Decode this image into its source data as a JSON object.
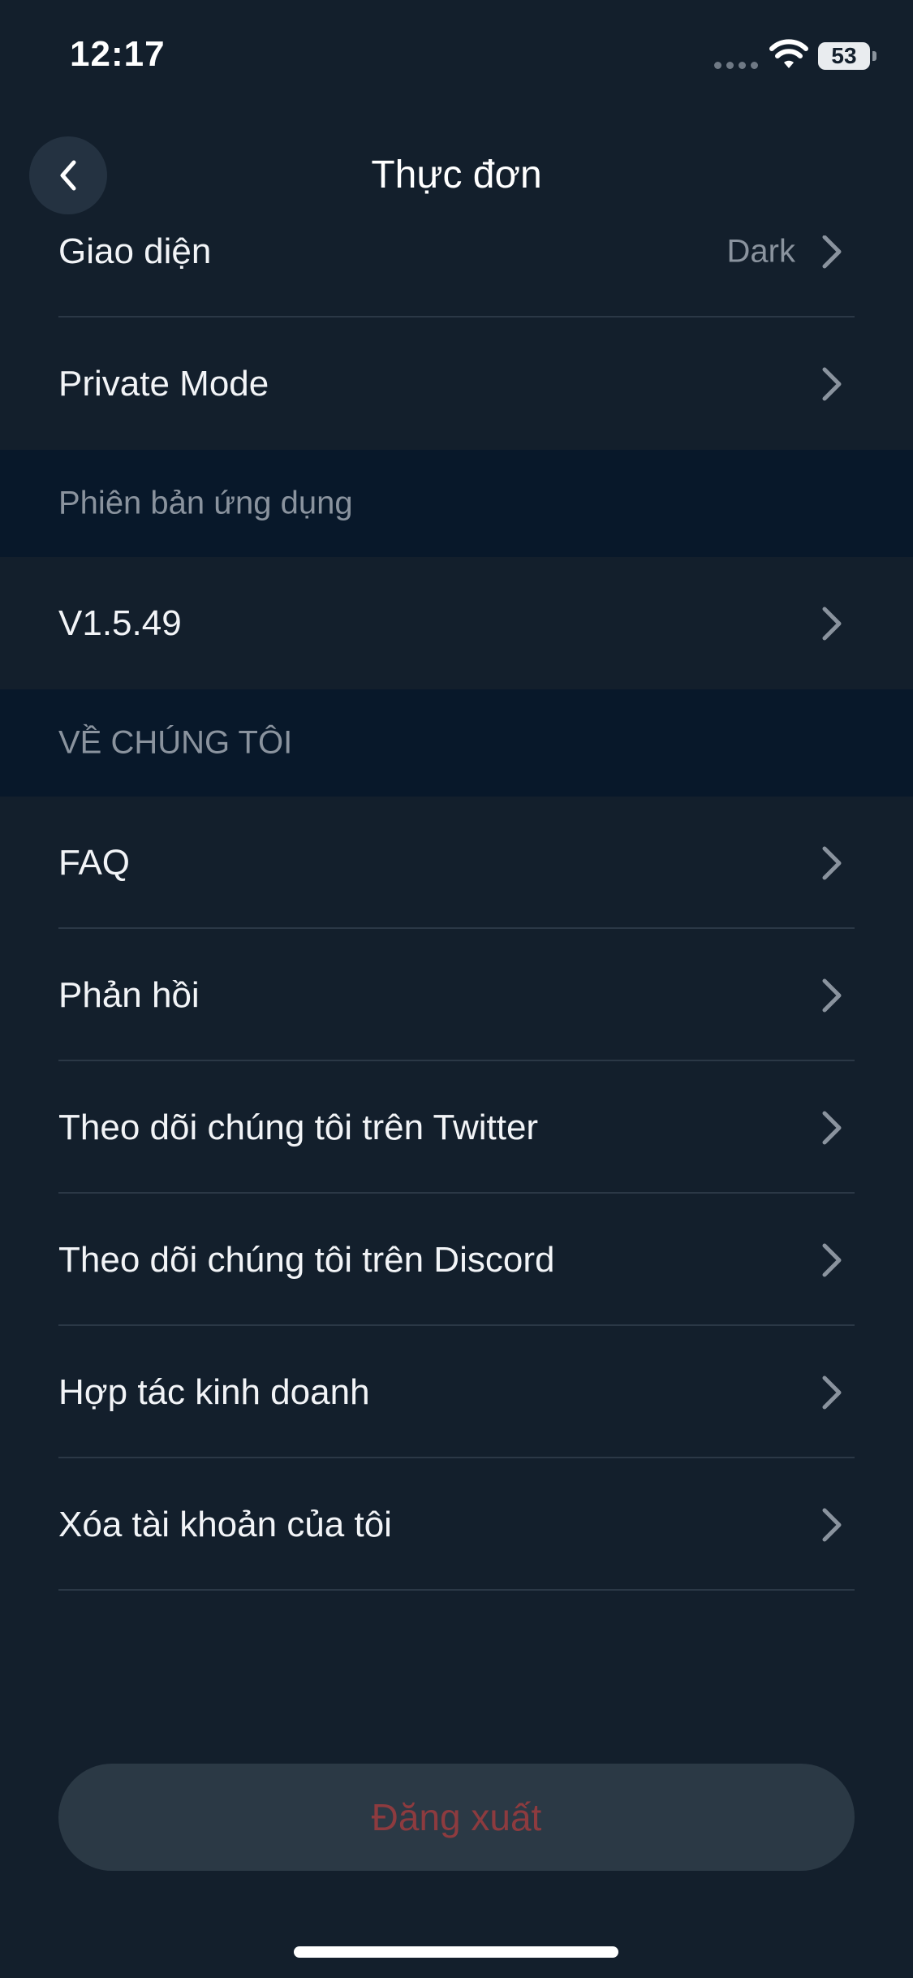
{
  "status_bar": {
    "time": "12:17",
    "battery": "53"
  },
  "header": {
    "title": "Thực đơn"
  },
  "rows": [
    {
      "label": "Giao diện",
      "value": "Dark"
    },
    {
      "label": "Private Mode",
      "value": ""
    }
  ],
  "sections": [
    {
      "title": "Phiên bản ứng dụng",
      "items": [
        {
          "label": "V1.5.49"
        }
      ]
    },
    {
      "title": "VỀ CHÚNG TÔI",
      "items": [
        {
          "label": "FAQ"
        },
        {
          "label": "Phản hồi"
        },
        {
          "label": "Theo dõi chúng tôi trên Twitter"
        },
        {
          "label": "Theo dõi chúng tôi trên Discord"
        },
        {
          "label": "Hợp tác kinh doanh"
        },
        {
          "label": "Xóa tài khoản của tôi"
        }
      ]
    }
  ],
  "logout": {
    "label": "Đăng xuất"
  },
  "colors": {
    "background": "#131f2c",
    "section_header": "#08182a",
    "logout_text": "#8d3b3f"
  }
}
